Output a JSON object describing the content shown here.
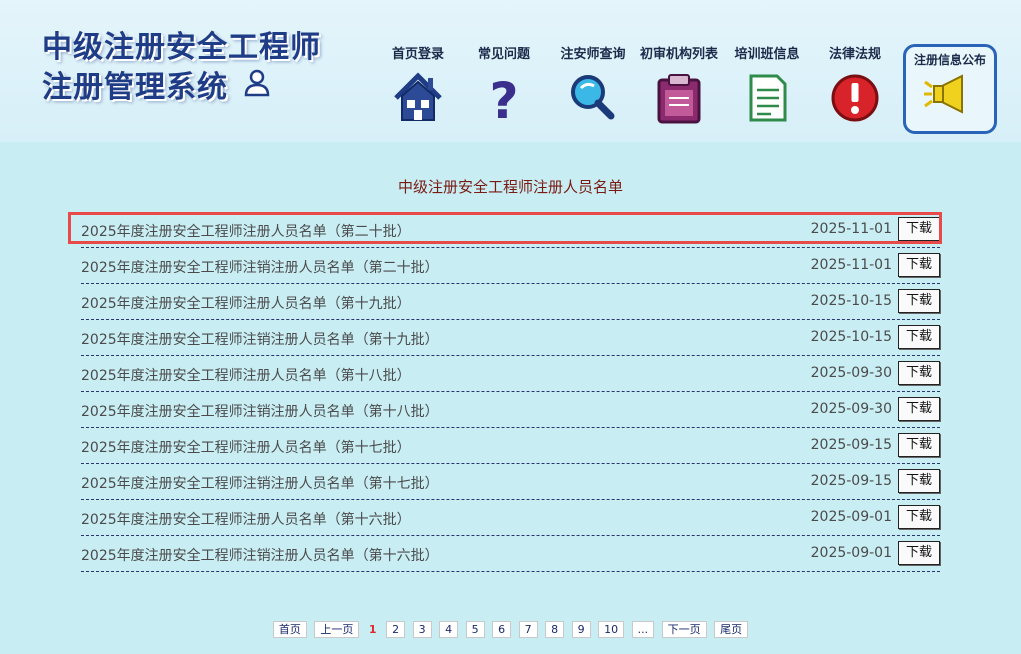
{
  "header": {
    "logo_line1": "中级注册安全工程师",
    "logo_line2": "注册管理系统"
  },
  "nav": [
    {
      "label": "首页登录"
    },
    {
      "label": "常见问题"
    },
    {
      "label": "注安师查询"
    },
    {
      "label": "初审机构列表"
    },
    {
      "label": "培训班信息"
    },
    {
      "label": "法律法规"
    },
    {
      "label": "注册信息公布"
    }
  ],
  "page": {
    "title": "中级注册安全工程师注册人员名单"
  },
  "rows": [
    {
      "name": "2025年度注册安全工程师注册人员名单（第二十批）",
      "date": "2025-11-01",
      "btn": "下载"
    },
    {
      "name": "2025年度注册安全工程师注销注册人员名单（第二十批）",
      "date": "2025-11-01",
      "btn": "下载"
    },
    {
      "name": "2025年度注册安全工程师注册人员名单（第十九批）",
      "date": "2025-10-15",
      "btn": "下载"
    },
    {
      "name": "2025年度注册安全工程师注销注册人员名单（第十九批）",
      "date": "2025-10-15",
      "btn": "下载"
    },
    {
      "name": "2025年度注册安全工程师注册人员名单（第十八批）",
      "date": "2025-09-30",
      "btn": "下载"
    },
    {
      "name": "2025年度注册安全工程师注销注册人员名单（第十八批）",
      "date": "2025-09-30",
      "btn": "下载"
    },
    {
      "name": "2025年度注册安全工程师注册人员名单（第十七批）",
      "date": "2025-09-15",
      "btn": "下载"
    },
    {
      "name": "2025年度注册安全工程师注销注册人员名单（第十七批）",
      "date": "2025-09-15",
      "btn": "下载"
    },
    {
      "name": "2025年度注册安全工程师注册人员名单（第十六批）",
      "date": "2025-09-01",
      "btn": "下载"
    },
    {
      "name": "2025年度注册安全工程师注销注册人员名单（第十六批）",
      "date": "2025-09-01",
      "btn": "下载"
    }
  ],
  "pager": {
    "first": "首页",
    "prev": "上一页",
    "current": "1",
    "pages": [
      "2",
      "3",
      "4",
      "5",
      "6",
      "7",
      "8",
      "9",
      "10"
    ],
    "ellipsis": "...",
    "next": "下一页",
    "last": "尾页"
  },
  "colors": {
    "background": "#c8eef4",
    "header_bg": "#dcf1f9",
    "logo_text": "#1f3d86",
    "title_text": "#7a1a12",
    "highlight_border": "#e84a4a",
    "active_nav_border": "#2a64b8"
  },
  "icons": [
    "user-icon",
    "house-icon",
    "question-icon",
    "magnifier-icon",
    "clipboard-icon",
    "document-icon",
    "alert-icon",
    "megaphone-icon"
  ]
}
